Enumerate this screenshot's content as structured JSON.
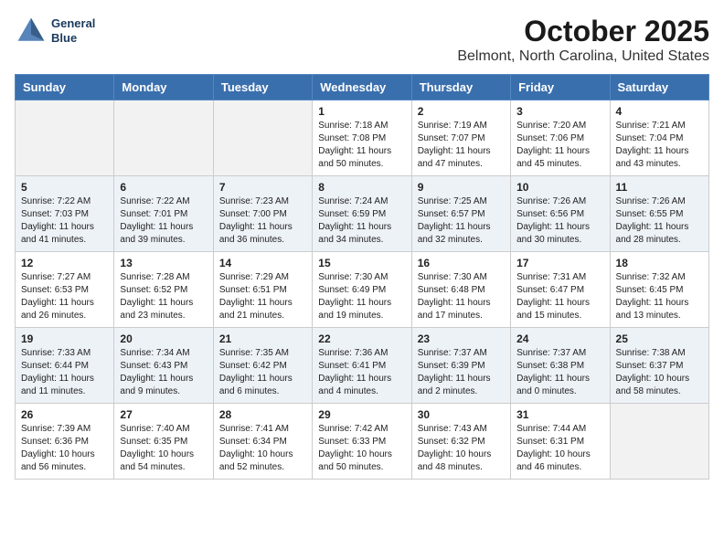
{
  "logo": {
    "line1": "General",
    "line2": "Blue"
  },
  "title": "October 2025",
  "subtitle": "Belmont, North Carolina, United States",
  "weekdays": [
    "Sunday",
    "Monday",
    "Tuesday",
    "Wednesday",
    "Thursday",
    "Friday",
    "Saturday"
  ],
  "weeks": [
    [
      {
        "day": null,
        "info": null
      },
      {
        "day": null,
        "info": null
      },
      {
        "day": null,
        "info": null
      },
      {
        "day": "1",
        "info": "Sunrise: 7:18 AM\nSunset: 7:08 PM\nDaylight: 11 hours\nand 50 minutes."
      },
      {
        "day": "2",
        "info": "Sunrise: 7:19 AM\nSunset: 7:07 PM\nDaylight: 11 hours\nand 47 minutes."
      },
      {
        "day": "3",
        "info": "Sunrise: 7:20 AM\nSunset: 7:06 PM\nDaylight: 11 hours\nand 45 minutes."
      },
      {
        "day": "4",
        "info": "Sunrise: 7:21 AM\nSunset: 7:04 PM\nDaylight: 11 hours\nand 43 minutes."
      }
    ],
    [
      {
        "day": "5",
        "info": "Sunrise: 7:22 AM\nSunset: 7:03 PM\nDaylight: 11 hours\nand 41 minutes."
      },
      {
        "day": "6",
        "info": "Sunrise: 7:22 AM\nSunset: 7:01 PM\nDaylight: 11 hours\nand 39 minutes."
      },
      {
        "day": "7",
        "info": "Sunrise: 7:23 AM\nSunset: 7:00 PM\nDaylight: 11 hours\nand 36 minutes."
      },
      {
        "day": "8",
        "info": "Sunrise: 7:24 AM\nSunset: 6:59 PM\nDaylight: 11 hours\nand 34 minutes."
      },
      {
        "day": "9",
        "info": "Sunrise: 7:25 AM\nSunset: 6:57 PM\nDaylight: 11 hours\nand 32 minutes."
      },
      {
        "day": "10",
        "info": "Sunrise: 7:26 AM\nSunset: 6:56 PM\nDaylight: 11 hours\nand 30 minutes."
      },
      {
        "day": "11",
        "info": "Sunrise: 7:26 AM\nSunset: 6:55 PM\nDaylight: 11 hours\nand 28 minutes."
      }
    ],
    [
      {
        "day": "12",
        "info": "Sunrise: 7:27 AM\nSunset: 6:53 PM\nDaylight: 11 hours\nand 26 minutes."
      },
      {
        "day": "13",
        "info": "Sunrise: 7:28 AM\nSunset: 6:52 PM\nDaylight: 11 hours\nand 23 minutes."
      },
      {
        "day": "14",
        "info": "Sunrise: 7:29 AM\nSunset: 6:51 PM\nDaylight: 11 hours\nand 21 minutes."
      },
      {
        "day": "15",
        "info": "Sunrise: 7:30 AM\nSunset: 6:49 PM\nDaylight: 11 hours\nand 19 minutes."
      },
      {
        "day": "16",
        "info": "Sunrise: 7:30 AM\nSunset: 6:48 PM\nDaylight: 11 hours\nand 17 minutes."
      },
      {
        "day": "17",
        "info": "Sunrise: 7:31 AM\nSunset: 6:47 PM\nDaylight: 11 hours\nand 15 minutes."
      },
      {
        "day": "18",
        "info": "Sunrise: 7:32 AM\nSunset: 6:45 PM\nDaylight: 11 hours\nand 13 minutes."
      }
    ],
    [
      {
        "day": "19",
        "info": "Sunrise: 7:33 AM\nSunset: 6:44 PM\nDaylight: 11 hours\nand 11 minutes."
      },
      {
        "day": "20",
        "info": "Sunrise: 7:34 AM\nSunset: 6:43 PM\nDaylight: 11 hours\nand 9 minutes."
      },
      {
        "day": "21",
        "info": "Sunrise: 7:35 AM\nSunset: 6:42 PM\nDaylight: 11 hours\nand 6 minutes."
      },
      {
        "day": "22",
        "info": "Sunrise: 7:36 AM\nSunset: 6:41 PM\nDaylight: 11 hours\nand 4 minutes."
      },
      {
        "day": "23",
        "info": "Sunrise: 7:37 AM\nSunset: 6:39 PM\nDaylight: 11 hours\nand 2 minutes."
      },
      {
        "day": "24",
        "info": "Sunrise: 7:37 AM\nSunset: 6:38 PM\nDaylight: 11 hours\nand 0 minutes."
      },
      {
        "day": "25",
        "info": "Sunrise: 7:38 AM\nSunset: 6:37 PM\nDaylight: 10 hours\nand 58 minutes."
      }
    ],
    [
      {
        "day": "26",
        "info": "Sunrise: 7:39 AM\nSunset: 6:36 PM\nDaylight: 10 hours\nand 56 minutes."
      },
      {
        "day": "27",
        "info": "Sunrise: 7:40 AM\nSunset: 6:35 PM\nDaylight: 10 hours\nand 54 minutes."
      },
      {
        "day": "28",
        "info": "Sunrise: 7:41 AM\nSunset: 6:34 PM\nDaylight: 10 hours\nand 52 minutes."
      },
      {
        "day": "29",
        "info": "Sunrise: 7:42 AM\nSunset: 6:33 PM\nDaylight: 10 hours\nand 50 minutes."
      },
      {
        "day": "30",
        "info": "Sunrise: 7:43 AM\nSunset: 6:32 PM\nDaylight: 10 hours\nand 48 minutes."
      },
      {
        "day": "31",
        "info": "Sunrise: 7:44 AM\nSunset: 6:31 PM\nDaylight: 10 hours\nand 46 minutes."
      },
      {
        "day": null,
        "info": null
      }
    ]
  ],
  "rowBgs": [
    "#ffffff",
    "#edf2f7",
    "#ffffff",
    "#edf2f7",
    "#ffffff"
  ]
}
